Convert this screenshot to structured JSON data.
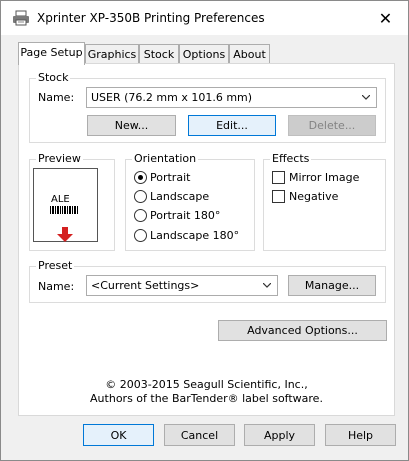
{
  "window": {
    "title": "Xprinter XP-350B Printing Preferences",
    "close_glyph": "✕"
  },
  "tabs": [
    {
      "label": "Page Setup",
      "active": true
    },
    {
      "label": "Graphics",
      "active": false
    },
    {
      "label": "Stock",
      "active": false
    },
    {
      "label": "Options",
      "active": false
    },
    {
      "label": "About",
      "active": false
    }
  ],
  "stock": {
    "group_label": "Stock",
    "name_label": "Name:",
    "name_value": "USER (76.2 mm x 101.6 mm)",
    "new_label": "New...",
    "edit_label": "Edit...",
    "delete_label": "Delete..."
  },
  "preview": {
    "group_label": "Preview",
    "label_text": "ALE"
  },
  "orientation": {
    "group_label": "Orientation",
    "options": [
      "Portrait",
      "Landscape",
      "Portrait 180°",
      "Landscape 180°"
    ],
    "selected": "Portrait"
  },
  "effects": {
    "group_label": "Effects",
    "mirror_label": "Mirror Image",
    "negative_label": "Negative"
  },
  "preset": {
    "group_label": "Preset",
    "name_label": "Name:",
    "name_value": "<Current Settings>",
    "manage_label": "Manage..."
  },
  "advanced_label": "Advanced Options...",
  "copyright": {
    "line1": "© 2003-2015 Seagull Scientific, Inc.,",
    "line2": "Authors of the BarTender® label software."
  },
  "footer": {
    "ok": "OK",
    "cancel": "Cancel",
    "apply": "Apply",
    "help": "Help"
  },
  "colors": {
    "focus_border": "#0078d7",
    "arrow_red": "#d42020"
  }
}
